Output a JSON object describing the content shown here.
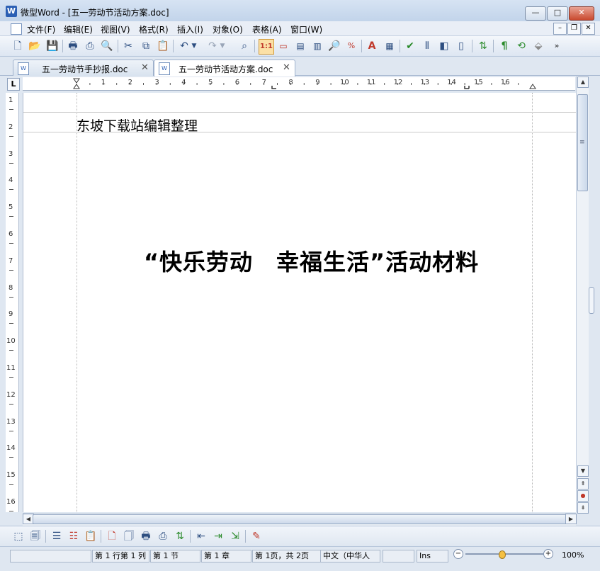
{
  "window": {
    "title": "微型Word - [五一劳动节活动方案.doc]",
    "app_icon": "word-icon",
    "min_label": "—",
    "max_label": "□",
    "close_label": "✕"
  },
  "menu": {
    "items": [
      "文件(F)",
      "编辑(E)",
      "视图(V)",
      "格式(R)",
      "插入(I)",
      "对象(O)",
      "表格(A)",
      "窗口(W)"
    ],
    "mdi_min": "–",
    "mdi_restore": "❐",
    "mdi_close": "✕"
  },
  "tabs": [
    {
      "label": "五一劳动节手抄报.doc",
      "active": false
    },
    {
      "label": "五一劳动节活动方案.doc",
      "active": true
    }
  ],
  "tab_close_glyph": "✕",
  "ruler": {
    "corner": "L",
    "h_numbers": [
      "1",
      "2",
      "3",
      "4",
      "5",
      "6",
      "7",
      "8",
      "9",
      "10",
      "11",
      "12",
      "13",
      "14",
      "15",
      "16"
    ],
    "v_numbers": [
      "1",
      "2",
      "3",
      "4",
      "5",
      "6",
      "7",
      "8",
      "9",
      "10",
      "11",
      "12",
      "13",
      "14",
      "15",
      "16"
    ]
  },
  "document": {
    "header_text": "东坡下载站编辑整理",
    "title": "“快乐劳动　幸福生活”活动材料"
  },
  "scroll": {
    "up": "▲",
    "down": "▼",
    "left": "◀",
    "right": "▶",
    "prev_page": "⇞",
    "browse": "●",
    "next_page": "⇟",
    "grip": "≡"
  },
  "status": {
    "blank1": "",
    "line_col": "第 1 行第 1 列",
    "section": "第 1 节",
    "chapter": "第 1 章",
    "page": "第 1页，共 2页",
    "language": "中文（中华人",
    "blank2": "",
    "ins": "Ins",
    "zoom": "100%",
    "zoom_out": "−",
    "zoom_in": "+"
  },
  "colors": {
    "accent": "#2b5fb4",
    "close_button": "#c94a2f",
    "zoom_knob": "#f5c042"
  }
}
